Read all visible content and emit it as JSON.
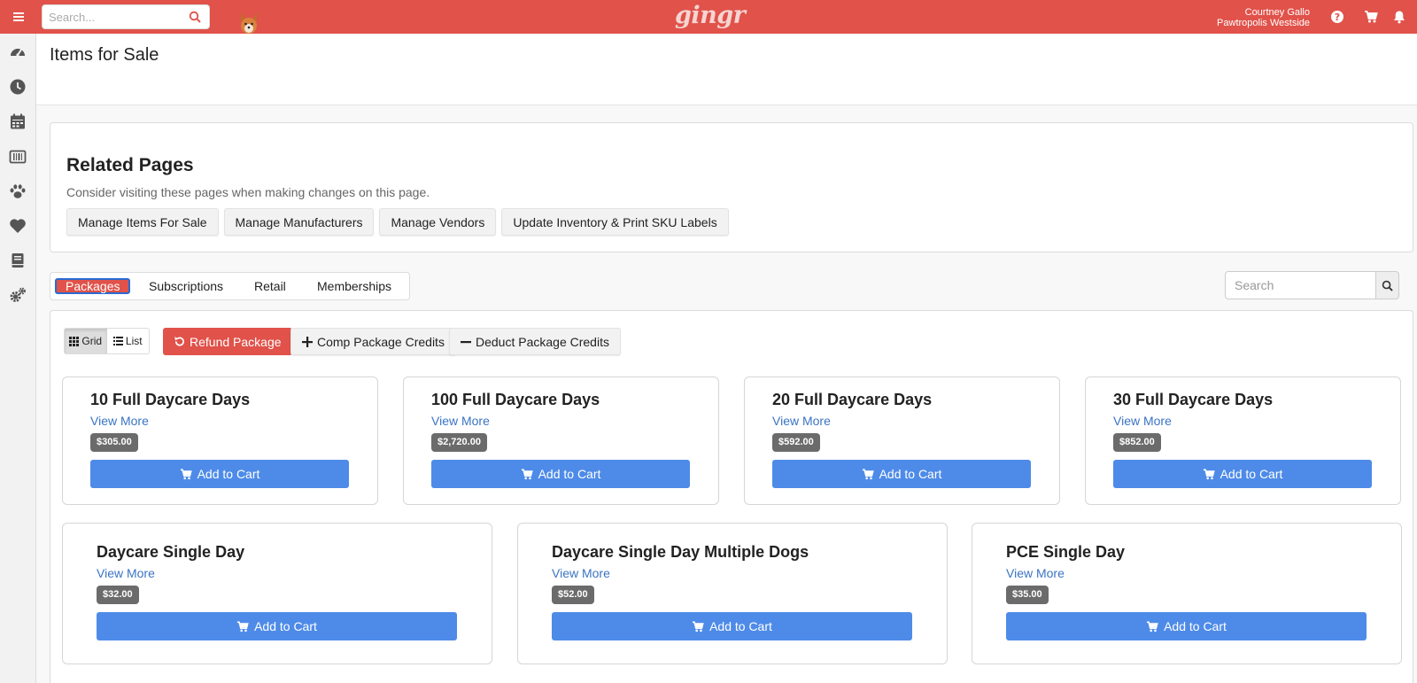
{
  "topbar": {
    "search_placeholder": "Search...",
    "logo": "gingr",
    "user_name": "Courtney Gallo",
    "location": "Pawtropolis Westside",
    "accent": "#e0524a"
  },
  "sidebar": {
    "items": [
      {
        "icon": "dashboard-icon"
      },
      {
        "icon": "clock-icon"
      },
      {
        "icon": "calendar-icon"
      },
      {
        "icon": "barcode-icon"
      },
      {
        "icon": "paw-icon"
      },
      {
        "icon": "heart-icon"
      },
      {
        "icon": "book-icon"
      },
      {
        "icon": "cogs-icon"
      }
    ]
  },
  "page": {
    "title": "Items for Sale"
  },
  "related": {
    "heading": "Related Pages",
    "subtitle": "Consider visiting these pages when making changes on this page.",
    "buttons": [
      "Manage Items For Sale",
      "Manage Manufacturers",
      "Manage Vendors",
      "Update Inventory & Print SKU Labels"
    ]
  },
  "tabs": [
    "Packages",
    "Subscriptions",
    "Retail",
    "Memberships"
  ],
  "active_tab": "Packages",
  "search": {
    "placeholder": "Search"
  },
  "toolbar": {
    "grid_label": "Grid",
    "list_label": "List",
    "refund_label": "Refund Package",
    "comp_label": "Comp Package Credits",
    "deduct_label": "Deduct Package Credits"
  },
  "packages": [
    {
      "name": "10 Full Daycare Days",
      "view_more": "View More",
      "price": "$305.00",
      "cart": "Add to Cart"
    },
    {
      "name": "100 Full Daycare Days",
      "view_more": "View More",
      "price": "$2,720.00",
      "cart": "Add to Cart"
    },
    {
      "name": "20 Full Daycare Days",
      "view_more": "View More",
      "price": "$592.00",
      "cart": "Add to Cart"
    },
    {
      "name": "30 Full Daycare Days",
      "view_more": "View More",
      "price": "$852.00",
      "cart": "Add to Cart"
    },
    {
      "name": "Daycare Single Day",
      "view_more": "View More",
      "price": "$32.00",
      "cart": "Add to Cart"
    },
    {
      "name": "Daycare Single Day Multiple Dogs",
      "view_more": "View More",
      "price": "$52.00",
      "cart": "Add to Cart"
    },
    {
      "name": "PCE Single Day",
      "view_more": "View More",
      "price": "$35.00",
      "cart": "Add to Cart"
    }
  ]
}
